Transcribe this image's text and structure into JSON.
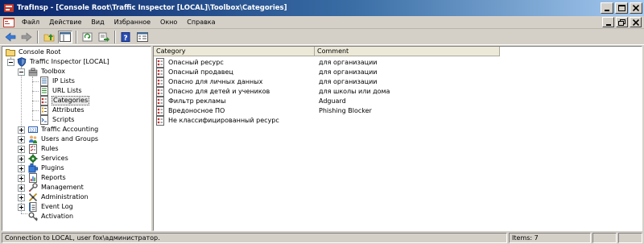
{
  "window": {
    "title": "TrafInsp - [Console Root\\Traffic Inspector [LOCAL]\\Toolbox\\Categories]",
    "accent": "#0a246a"
  },
  "menu": [
    "Файл",
    "Действие",
    "Вид",
    "Избранное",
    "Окно",
    "Справка"
  ],
  "toolbar": {
    "icons": [
      "back-icon",
      "forward-icon",
      "up-folder-icon",
      "show-tree-icon",
      "refresh-icon",
      "export-icon",
      "help-icon",
      "properties-icon"
    ]
  },
  "tree": {
    "root": "Console Root",
    "server": "Traffic Inspector [LOCAL]",
    "toolbox": "Toolbox",
    "toolbox_children": [
      "IP Lists",
      "URL Lists",
      "Categories",
      "Attributes",
      "Scripts"
    ],
    "selected": "Categories",
    "sections": [
      "Traffic Accounting",
      "Users and Groups",
      "Rules",
      "Services",
      "Plugins",
      "Reports",
      "Management",
      "Administration",
      "Event Log",
      "Activation"
    ]
  },
  "list": {
    "columns": [
      "Category",
      "Comment"
    ],
    "rows": [
      {
        "category": "Опасный ресурс",
        "comment": "для организации"
      },
      {
        "category": "Опасный продавец",
        "comment": "для организации"
      },
      {
        "category": "Опасно для личных данных",
        "comment": "для организации"
      },
      {
        "category": "Опасно для детей и учеников",
        "comment": "для школы или дома"
      },
      {
        "category": "Фильтр рекламы",
        "comment": "Adguard"
      },
      {
        "category": "Вредоносное ПО",
        "comment": "Phishing Blocker"
      },
      {
        "category": "Не классифицированный ресурс",
        "comment": ""
      }
    ]
  },
  "status": {
    "connection": "Connection to LOCAL, user fox\\администратор.",
    "items": "Items: 7"
  }
}
